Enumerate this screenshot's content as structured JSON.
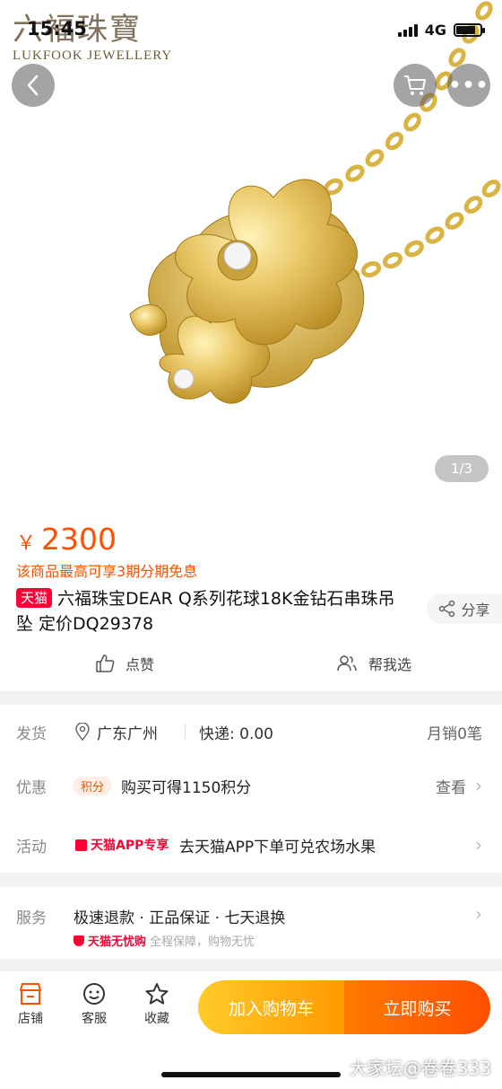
{
  "status_bar": {
    "time": "15:45",
    "network": "4G"
  },
  "brand": {
    "name_cn": "六福珠寶",
    "name_en": "LUKFOOK JEWELLERY"
  },
  "gallery": {
    "counter": "1/3"
  },
  "header_icons": [
    "back-icon",
    "cart-icon",
    "more-icon"
  ],
  "product": {
    "currency": "￥",
    "price": "2300",
    "installment": "该商品最高可享3期分期免息",
    "tag": "天猫",
    "title": "六福珠宝DEAR Q系列花球18K金钻石串珠吊坠 定价DQ29378",
    "share_label": "分享",
    "like_label": "点赞",
    "help_label": "帮我选"
  },
  "delivery": {
    "label": "发货",
    "location": "广东广州",
    "shipping": "快递: 0.00",
    "monthly_sales": "月销0笔"
  },
  "promo": {
    "label": "优惠",
    "badge": "积分",
    "text": "购买可得1150积分",
    "action": "查看"
  },
  "activity": {
    "label": "活动",
    "tag": "天猫APP专享",
    "text": "去天猫APP下单可兑农场水果"
  },
  "service": {
    "label": "服务",
    "items": "极速退款 · 正品保证 · 七天退换",
    "sub_brand": "天猫无忧购",
    "sub_text": "全程保障，购物无忧"
  },
  "bottom_bar": {
    "tabs": [
      {
        "label": "店铺",
        "icon": "shop-icon"
      },
      {
        "label": "客服",
        "icon": "service-icon"
      },
      {
        "label": "收藏",
        "icon": "star-icon"
      }
    ],
    "add_to_cart": "加入购物车",
    "buy_now": "立即购买"
  },
  "watermark": "大家坛@卷卷333",
  "colors": {
    "accent": "#ff5000",
    "tmall": "#ff0036",
    "cart_btn": "#ffb300",
    "buy_btn": "#ff5f00"
  }
}
